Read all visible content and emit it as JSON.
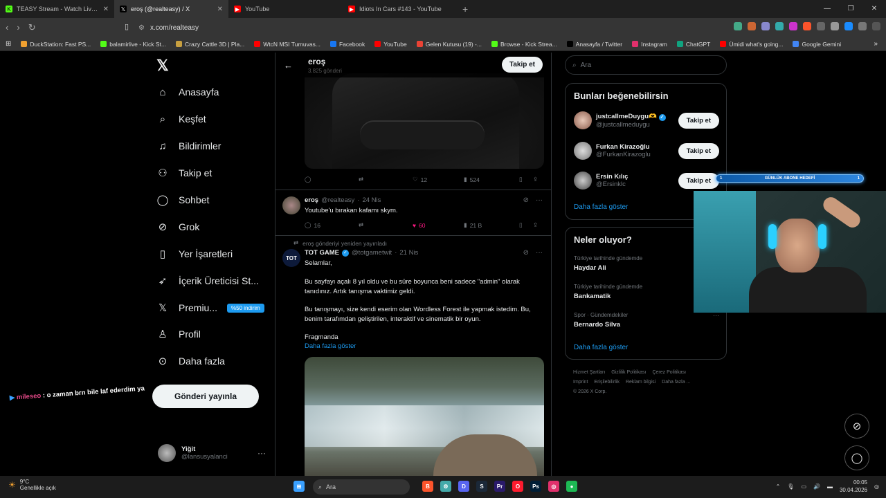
{
  "browser": {
    "tabs": [
      {
        "label": "TEASY Stream - Watch Live on Ki",
        "icon": "kick-icon",
        "color": "#53fc18",
        "active": false
      },
      {
        "label": "eroş (@realteasy) / X",
        "icon": "x-icon",
        "color": "#000000",
        "active": true
      },
      {
        "label": "YouTube",
        "icon": "youtube-icon",
        "color": "#ff0000",
        "active": false
      },
      {
        "label": "Idiots In Cars #143 - YouTube",
        "icon": "youtube-icon",
        "color": "#ff0000",
        "active": false
      }
    ],
    "new_tab": "+",
    "url": "x.com/realteasy",
    "bookmarks": [
      {
        "label": "DuckStation: Fast PS...",
        "color": "#f0a030"
      },
      {
        "label": "balamirlive - Kick St...",
        "color": "#53fc18"
      },
      {
        "label": "Crazy Cattle 3D | Pla...",
        "color": "#c8a040"
      },
      {
        "label": "WtcN MSI Turnuvas...",
        "color": "#ff0000"
      },
      {
        "label": "Facebook",
        "color": "#1877f2"
      },
      {
        "label": "YouTube",
        "color": "#ff0000"
      },
      {
        "label": "Gelen Kutusu (19) -...",
        "color": "#ea4335"
      },
      {
        "label": "Browse - Kick Strea...",
        "color": "#53fc18"
      },
      {
        "label": "Anasayfa / Twitter",
        "color": "#000000"
      },
      {
        "label": "Instagram",
        "color": "#e1306c"
      },
      {
        "label": "ChatGPT",
        "color": "#10a37f"
      },
      {
        "label": "Ümidi what's going...",
        "color": "#ff0000"
      },
      {
        "label": "Google Gemini",
        "color": "#4285f4"
      }
    ]
  },
  "sidebar": {
    "items": [
      {
        "label": "Anasayfa",
        "icon": "home-icon",
        "glyph": "⌂"
      },
      {
        "label": "Keşfet",
        "icon": "search-icon",
        "glyph": "⌕"
      },
      {
        "label": "Bildirimler",
        "icon": "bell-icon",
        "glyph": "♫"
      },
      {
        "label": "Takip et",
        "icon": "add-person-icon",
        "glyph": "⚇"
      },
      {
        "label": "Sohbet",
        "icon": "chat-icon",
        "glyph": "◯"
      },
      {
        "label": "Grok",
        "icon": "grok-icon",
        "glyph": "⊘"
      },
      {
        "label": "Yer İşaretleri",
        "icon": "bookmark-icon",
        "glyph": "▯"
      },
      {
        "label": "İçerik Üreticisi St...",
        "icon": "rocket-icon",
        "glyph": "➶"
      },
      {
        "label": "Premiu...",
        "icon": "x-premium-icon",
        "glyph": "𝕏"
      },
      {
        "label": "Profil",
        "icon": "profile-icon",
        "glyph": "♙"
      },
      {
        "label": "Daha fazla",
        "icon": "more-circle-icon",
        "glyph": "⊙"
      }
    ],
    "premium_badge": "%50 indirim",
    "post_button": "Gönderi yayınla",
    "account": {
      "name": "Yiğit",
      "handle": "@lansusyalanci"
    }
  },
  "chat_overlay": {
    "user": "mileseo",
    "message": ": o zaman brn bile laf ederdim ya"
  },
  "profile_header": {
    "name": "eroş",
    "subtitle": "3.825 gönderi",
    "follow": "Takip et"
  },
  "tweets": [
    {
      "stats": {
        "replies": "",
        "likes": "12",
        "views": "524"
      }
    },
    {
      "name": "eroş",
      "handle": "@realteasy",
      "date": "24 Nis",
      "text": "Youtube'u bırakan kafamı skym.",
      "stats": {
        "replies": "16",
        "likes": "60",
        "views": "21 B"
      }
    },
    {
      "retweet_note": "eroş gönderiyi yeniden yayınladı",
      "name": "TOT GAME",
      "handle": "@totgametwit",
      "date": "21 Nis",
      "lines": [
        "Selamlar,",
        "Bu sayfayı açalı 8 yıl oldu ve bu süre boyunca beni sadece \"admin\" olarak tanıdınız. Artık tanışma vaktimiz geldi.",
        "Bu tanışmayı, size kendi eserim olan Wordless Forest ile yapmak istedim. Bu, benim tarafımdan geliştirilen, interaktif ve sinematik bir oyun.",
        "Fragmanda"
      ],
      "show_more": "Daha fazla göster"
    }
  ],
  "right": {
    "search_placeholder": "Ara",
    "who_to_follow": {
      "title": "Bunları beğenebilirsin",
      "users": [
        {
          "name": "justcallmeDuygu🫶",
          "handle": "@justcallmeduygu",
          "verified": true,
          "button": "Takip et"
        },
        {
          "name": "Furkan Kirazoğlu",
          "handle": "@FurkanKirazoglu",
          "verified": false,
          "button": "Takip et"
        },
        {
          "name": "Ersin Kılıç",
          "handle": "@Ersinklc",
          "verified": false,
          "button": "Takip et"
        }
      ],
      "show_more": "Daha fazla göster"
    },
    "trends": {
      "title": "Neler oluyor?",
      "items": [
        {
          "context": "Türkiye tarihinde gündemde",
          "topic": "Haydar Ali"
        },
        {
          "context": "Türkiye tarihinde gündemde",
          "topic": "Bankamatik"
        },
        {
          "context": "Spor · Gündemdekiler",
          "topic": "Bernardo Silva"
        }
      ],
      "show_more": "Daha fazla göster"
    },
    "footer": [
      "Hizmet Şartları",
      "Gizlilik Politikası",
      "Çerez Politikası",
      "Imprint",
      "Erişilebilirlik",
      "Reklam bilgisi",
      "Daha fazla ...",
      "© 2026 X Corp."
    ]
  },
  "stream_overlay": {
    "goal_left": "1",
    "goal_label": "GÜNLÜK ABONE HEDEFİ",
    "goal_right": "1"
  },
  "taskbar": {
    "weather_temp": "9°C",
    "weather_desc": "Genellikle açık",
    "search": "Ara",
    "time": "00:05",
    "date": "30.04.2026",
    "lang": "",
    "apps": [
      {
        "name": "start-icon",
        "color": "#3aa0ff"
      },
      {
        "name": "brave-icon",
        "color": "#fb542b"
      },
      {
        "name": "settings-icon",
        "color": "#4aa"
      },
      {
        "name": "discord-icon",
        "color": "#5865f2"
      },
      {
        "name": "steam-icon",
        "color": "#1b2838"
      },
      {
        "name": "premiere-icon",
        "color": "#2a1a6a"
      },
      {
        "name": "opera-icon",
        "color": "#ff1b2d"
      },
      {
        "name": "photoshop-icon",
        "color": "#001e36"
      },
      {
        "name": "instagram-icon",
        "color": "#e1306c"
      },
      {
        "name": "spotify-icon",
        "color": "#1db954"
      }
    ]
  }
}
